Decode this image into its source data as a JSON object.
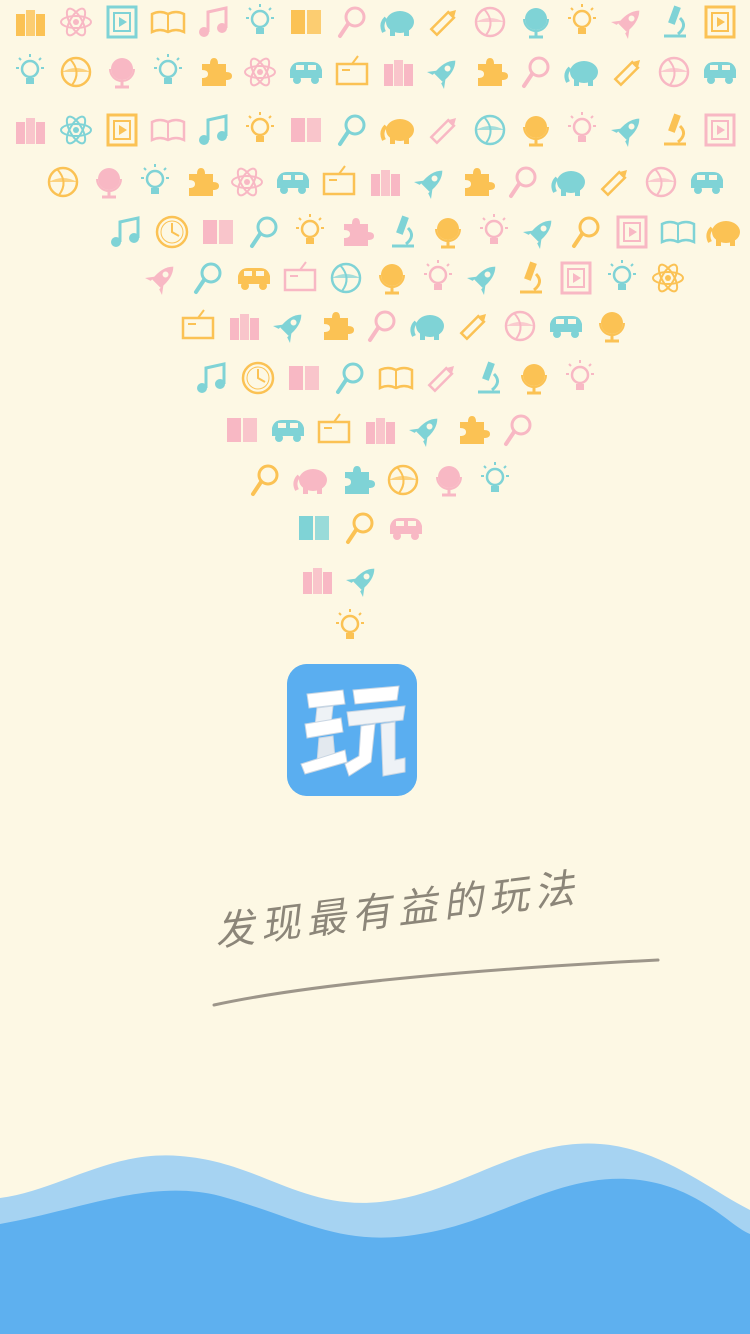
{
  "screen": "splash",
  "app_icon": {
    "glyph": "玩",
    "background_color": "#5aaef0"
  },
  "tagline": "发现最有益的玩法",
  "palette": {
    "background": "#fdf8e4",
    "orange": "#fbc254",
    "pink": "#f8b8c4",
    "teal": "#7fd3d6",
    "wave_light": "#a6d3f2",
    "wave_dark": "#5eb0ef",
    "text": "#8c8679"
  },
  "icon_rows": [
    [
      "books",
      "atom",
      "film",
      "open-book",
      "music-note",
      "bulb",
      "book",
      "magnifier",
      "elephant",
      "pencil",
      "ball",
      "globe",
      "bulb",
      "rocket",
      "microscope",
      "film"
    ],
    [
      "bulb",
      "ball",
      "globe",
      "bulb",
      "puzzle",
      "atom",
      "car",
      "board",
      "books",
      "rocket",
      "puzzle",
      "magnifier",
      "elephant",
      "pencil",
      "ball",
      "car"
    ],
    [
      "books",
      "atom",
      "film",
      "open-book",
      "music-note",
      "bulb",
      "book",
      "magnifier",
      "elephant",
      "pencil",
      "ball",
      "globe",
      "bulb",
      "rocket",
      "microscope",
      "film"
    ],
    [
      "ball",
      "globe",
      "bulb",
      "puzzle",
      "atom",
      "car",
      "board",
      "books",
      "rocket",
      "puzzle",
      "magnifier",
      "elephant",
      "pencil",
      "ball",
      "car"
    ],
    [
      "music-note",
      "clock",
      "book",
      "magnifier",
      "bulb",
      "puzzle",
      "microscope",
      "globe",
      "bulb",
      "rocket",
      "magnifier",
      "film",
      "open-book",
      "elephant"
    ],
    [
      "rocket",
      "magnifier",
      "car",
      "board",
      "ball",
      "globe",
      "bulb",
      "rocket",
      "microscope",
      "film",
      "bulb",
      "atom"
    ],
    [
      "board",
      "books",
      "rocket",
      "puzzle",
      "magnifier",
      "elephant",
      "pencil",
      "ball",
      "car",
      "globe"
    ],
    [
      "music-note",
      "clock",
      "book",
      "magnifier",
      "open-book",
      "pencil",
      "microscope",
      "globe",
      "bulb"
    ],
    [
      "book",
      "car",
      "board",
      "books",
      "rocket",
      "puzzle",
      "magnifier"
    ],
    [
      "magnifier",
      "elephant",
      "puzzle",
      "ball",
      "globe",
      "bulb"
    ],
    [
      "book",
      "magnifier",
      "car"
    ],
    [
      "books",
      "rocket"
    ],
    [
      "bulb"
    ]
  ]
}
